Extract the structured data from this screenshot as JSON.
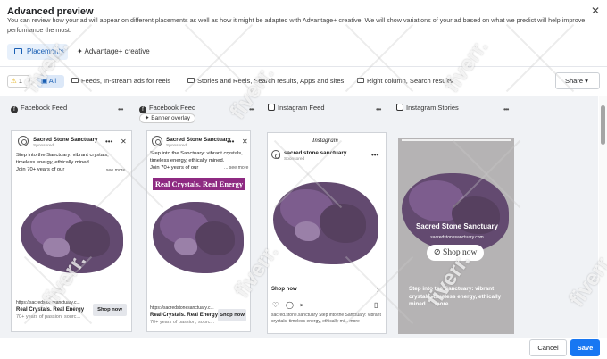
{
  "header": {
    "title": "Advanced preview",
    "description": "You can review how your ad will appear on different placements as well as how it might be adapted with Advantage+ creative. We will show variations of your ad based on what we predict will help improve performance the most."
  },
  "tabs": [
    {
      "label": "Placements"
    },
    {
      "label": "Advantage+ creative"
    }
  ],
  "filters": {
    "warning_count": "1",
    "all_label": "All",
    "items": [
      "Feeds, In-stream ads for reels",
      "Stories and Reels, Search results, Apps and sites",
      "Right column, Search results"
    ],
    "share_label": "Share"
  },
  "columns": [
    {
      "label": "Facebook Feed"
    },
    {
      "label": "Facebook Feed",
      "badge": "Banner overlay"
    },
    {
      "label": "Instagram Feed"
    },
    {
      "label": "Instagram Stories"
    }
  ],
  "ad": {
    "brand": "Sacred Stone Sanctuary",
    "sponsored": "Sponsored",
    "primary_text_1": "Step into the Sanctuary: vibrant crystals, timeless energy, ethically mined.",
    "primary_text_2": "Join 70+ years of our",
    "see_more": "... see more",
    "url": "https://sacredstonesanctuary.c...",
    "headline": "Real Crystals. Real Energy",
    "description": "70+ years of passion, sourc...",
    "cta": "Shop now",
    "banner": "Real Crystals. Real Energy",
    "ig_handle": "sacred.stone.sanctuary",
    "ig_caption": "sacred.stone.sanctuary Step into the Sanctuary: vibrant crystals, timeless energy, ethically mi... more",
    "ig_logo": "Instagram",
    "story_title": "Sacred Stone Sanctuary",
    "story_url": "sacredstonesanctuary.com",
    "story_cta": "Shop now",
    "story_text": "Step into the Sanctuary: vibrant crystals, timeless energy, ethically mined. ... more"
  },
  "footer": {
    "cancel": "Cancel",
    "save": "Save"
  },
  "watermark": "fiverr.",
  "colors": {
    "accent": "#1877f2",
    "amethyst": "#6a4b7a",
    "banner": "#8e2a82"
  }
}
